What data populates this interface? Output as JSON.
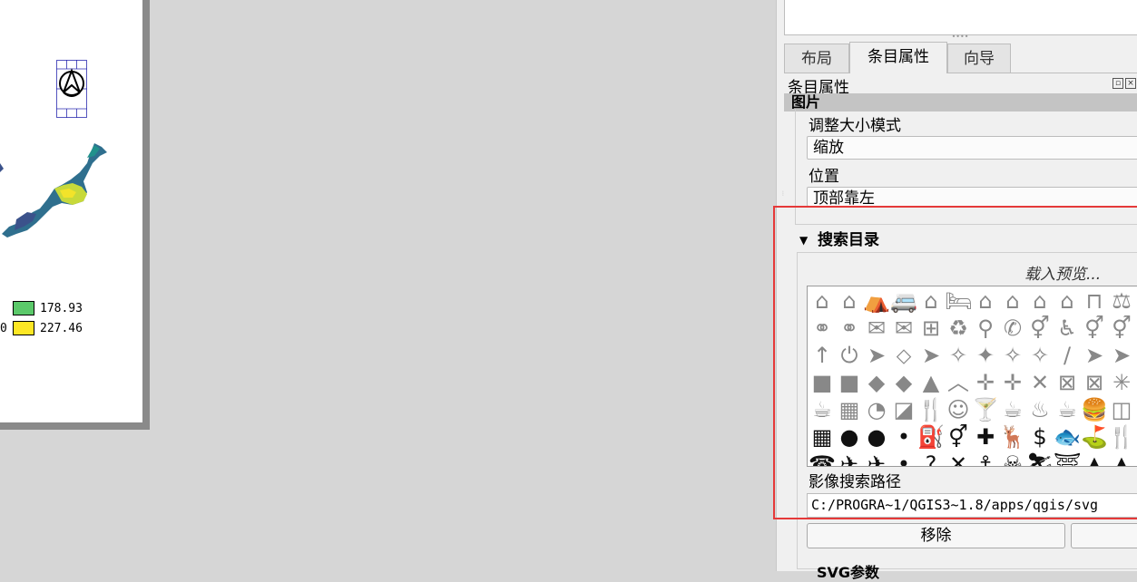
{
  "layout_page": {
    "legend": [
      {
        "left_text": "",
        "color": "#5bc96a",
        "value": "178.93"
      },
      {
        "left_text": "0",
        "color": "#fde725",
        "value": "227.46"
      }
    ]
  },
  "panel": {
    "tabs": [
      {
        "label": "布局",
        "active": false
      },
      {
        "label": "条目属性",
        "active": true
      },
      {
        "label": "向导",
        "active": false
      }
    ],
    "dock_title": "条目属性",
    "group_header": "图片",
    "resize_mode_label": "调整大小模式",
    "resize_mode_value": "缩放",
    "placement_label": "位置",
    "placement_value": "顶部靠左",
    "search_dirs": {
      "title": "搜索目录",
      "loading_text": "载入预览...",
      "icon_rows": [
        {
          "style": "outline",
          "icons": [
            "⌂",
            "⌂",
            "⛺",
            "🚐",
            "⌂",
            "🛏",
            "⌂",
            "⌂",
            "⌂",
            "⌂",
            "⊓",
            "⚖"
          ]
        },
        {
          "style": "outline",
          "icons": [
            "⚭",
            "⚭",
            "✉",
            "✉",
            "⊞",
            "♻",
            "⚲",
            "✆",
            "⚥",
            "♿",
            "⚥",
            "⚥"
          ]
        },
        {
          "style": "outline",
          "icons": [
            "↑",
            "⏻",
            "➤",
            "⬦",
            "➤",
            "✧",
            "✦",
            "✧",
            "✧",
            "/",
            "➤",
            "➤"
          ]
        },
        {
          "style": "outline",
          "icons": [
            "■",
            "■",
            "◆",
            "◆",
            "▲",
            "︿",
            "✛",
            "✛",
            "✕",
            "⊠",
            "⊠",
            "✳"
          ]
        },
        {
          "style": "outline",
          "icons": [
            "☕",
            "▦",
            "◔",
            "◪",
            "🍴",
            "☺",
            "🍸",
            "☕",
            "♨",
            "☕",
            "🍔",
            "◫"
          ]
        },
        {
          "style": "black",
          "icons": [
            "▦",
            "●",
            "●",
            "•",
            "⛽",
            "⚥",
            "✚",
            "🦌",
            "$",
            "🐟",
            "⛳",
            "🍴"
          ]
        },
        {
          "style": "black",
          "icons": [
            "☎",
            "✈",
            "✈",
            "•",
            "?",
            "✕",
            "⚓",
            "☠",
            "⛷",
            "⛩",
            "▲",
            "▲"
          ]
        }
      ],
      "path_label": "影像搜索路径",
      "path_value": "C:/PROGRA~1/QGIS3~1.8/apps/qgis/svg",
      "remove_button": "移除",
      "add_button": ""
    },
    "next_group_label": "SVG参数"
  },
  "highlight_color": "#e53939"
}
